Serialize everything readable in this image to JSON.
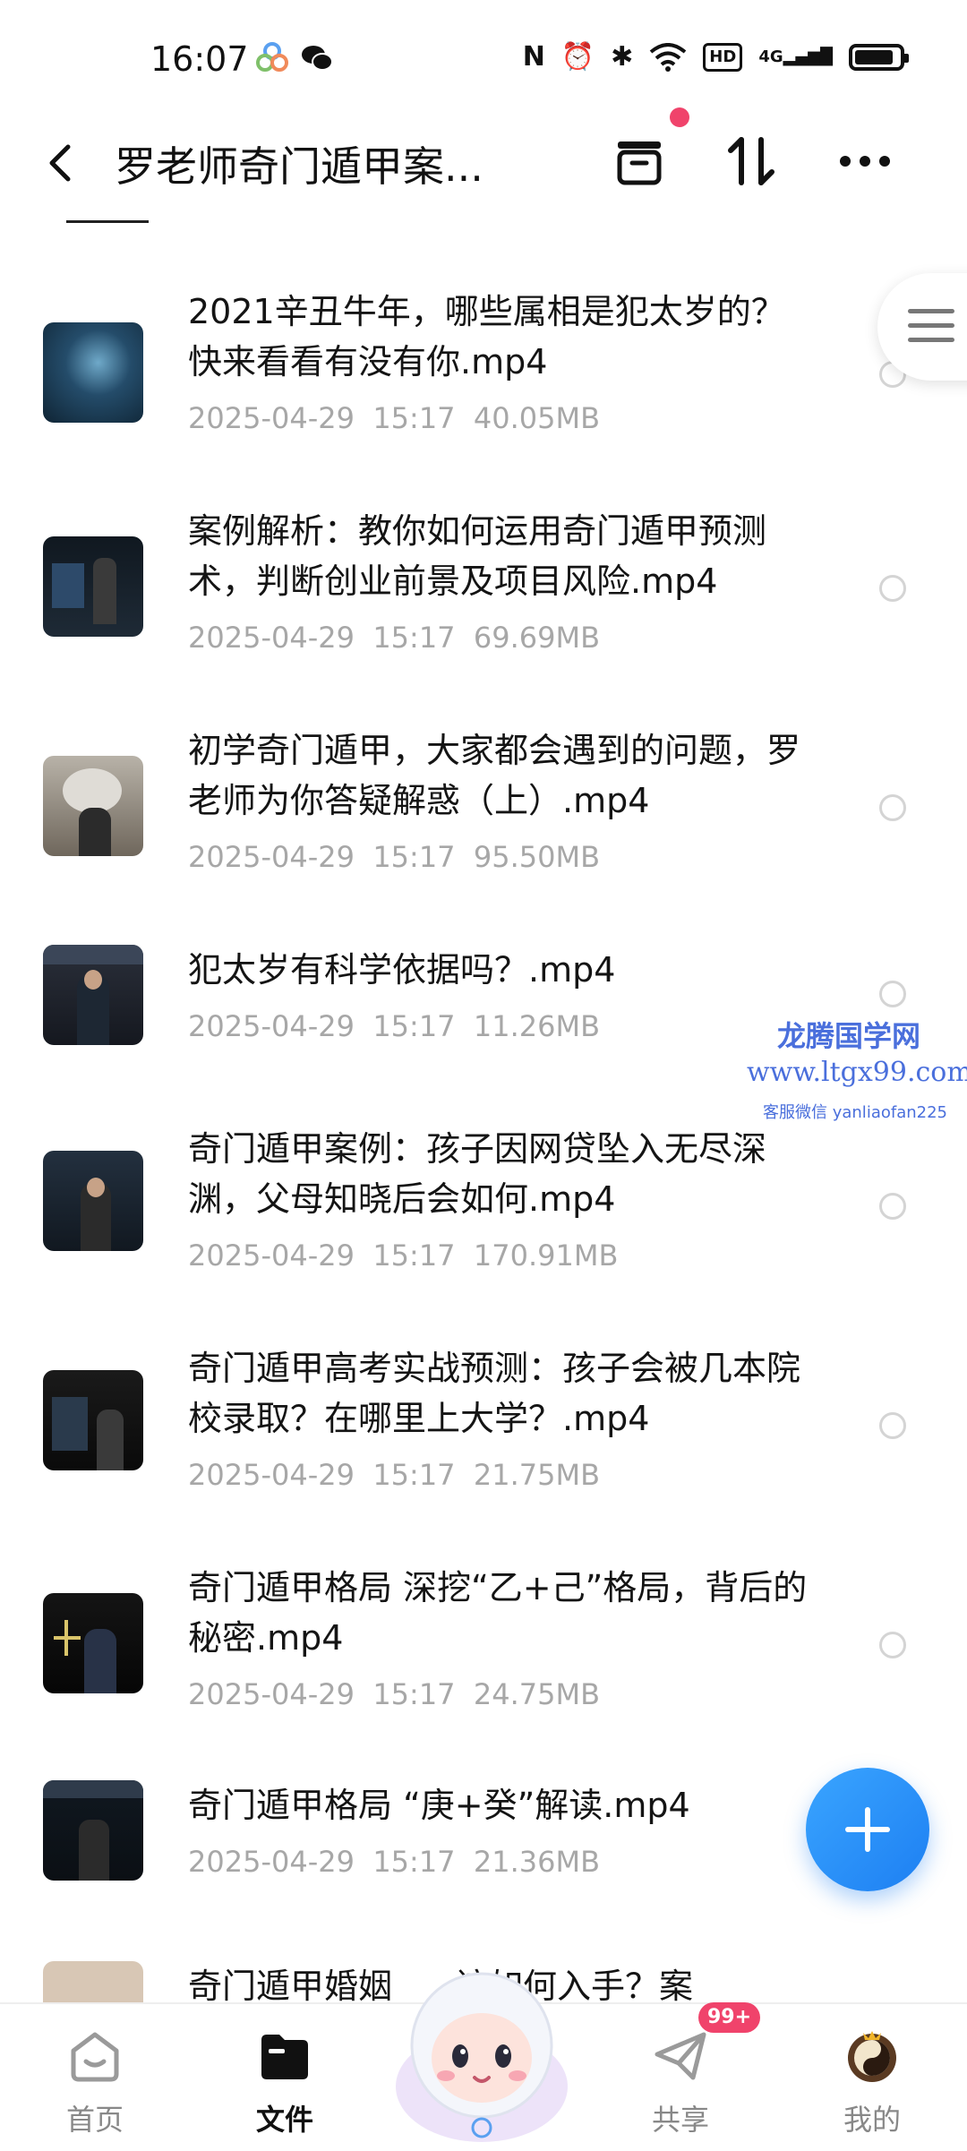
{
  "status_bar": {
    "time": "16:07",
    "right_icons": [
      "nfc-icon",
      "alarm-icon",
      "bluetooth-icon",
      "wifi-icon",
      "hd-icon",
      "4g-signal-icon",
      "battery-icon"
    ],
    "hd_label": "HD",
    "network_label": "4G"
  },
  "header": {
    "title": "罗老师奇门遁甲案...",
    "icons": [
      "back-icon",
      "archive-icon",
      "sort-icon",
      "more-icon"
    ]
  },
  "files": [
    {
      "name": "2021辛丑牛年，哪些属相是犯太岁的？快来看看有没有你.mp4",
      "date": "2025-04-29",
      "time": "15:17",
      "size": "40.05MB"
    },
    {
      "name": "案例解析：教你如何运用奇门遁甲预测术，判断创业前景及项目风险.mp4",
      "date": "2025-04-29",
      "time": "15:17",
      "size": "69.69MB"
    },
    {
      "name": "初学奇门遁甲，大家都会遇到的问题，罗老师为你答疑解惑（上）.mp4",
      "date": "2025-04-29",
      "time": "15:17",
      "size": "95.50MB"
    },
    {
      "name": "犯太岁有科学依据吗？.mp4",
      "date": "2025-04-29",
      "time": "15:17",
      "size": "11.26MB"
    },
    {
      "name": "奇门遁甲案例：孩子因网贷坠入无尽深渊，父母知晓后会如何.mp4",
      "date": "2025-04-29",
      "time": "15:17",
      "size": "170.91MB"
    },
    {
      "name": "奇门遁甲高考实战预测：孩子会被几本院校录取？在哪里上大学？.mp4",
      "date": "2025-04-29",
      "time": "15:17",
      "size": "21.75MB"
    },
    {
      "name": "奇门遁甲格局 深挖“乙+己”格局，背后的秘密.mp4",
      "date": "2025-04-29",
      "time": "15:17",
      "size": "24.75MB"
    },
    {
      "name": "奇门遁甲格局 “庚+癸”解读.mp4",
      "date": "2025-04-29",
      "time": "15:17",
      "size": "21.36MB"
    },
    {
      "name": "奇门遁甲婚姻",
      "date": "",
      "time": "",
      "size": ""
    }
  ],
  "partial_row_text_tail": "该如何入手？案",
  "watermark": {
    "line1": "龙腾国学网",
    "line2": "www.ltgx99.com",
    "line3": "客服微信 yanliaofan225"
  },
  "nav": {
    "home": "首页",
    "files": "文件",
    "share": "共享",
    "mine": "我的",
    "share_badge": "99+"
  },
  "colors": {
    "accent": "#1d7ff2",
    "badge": "#f0436b",
    "meta_text": "#a7a7a7"
  }
}
